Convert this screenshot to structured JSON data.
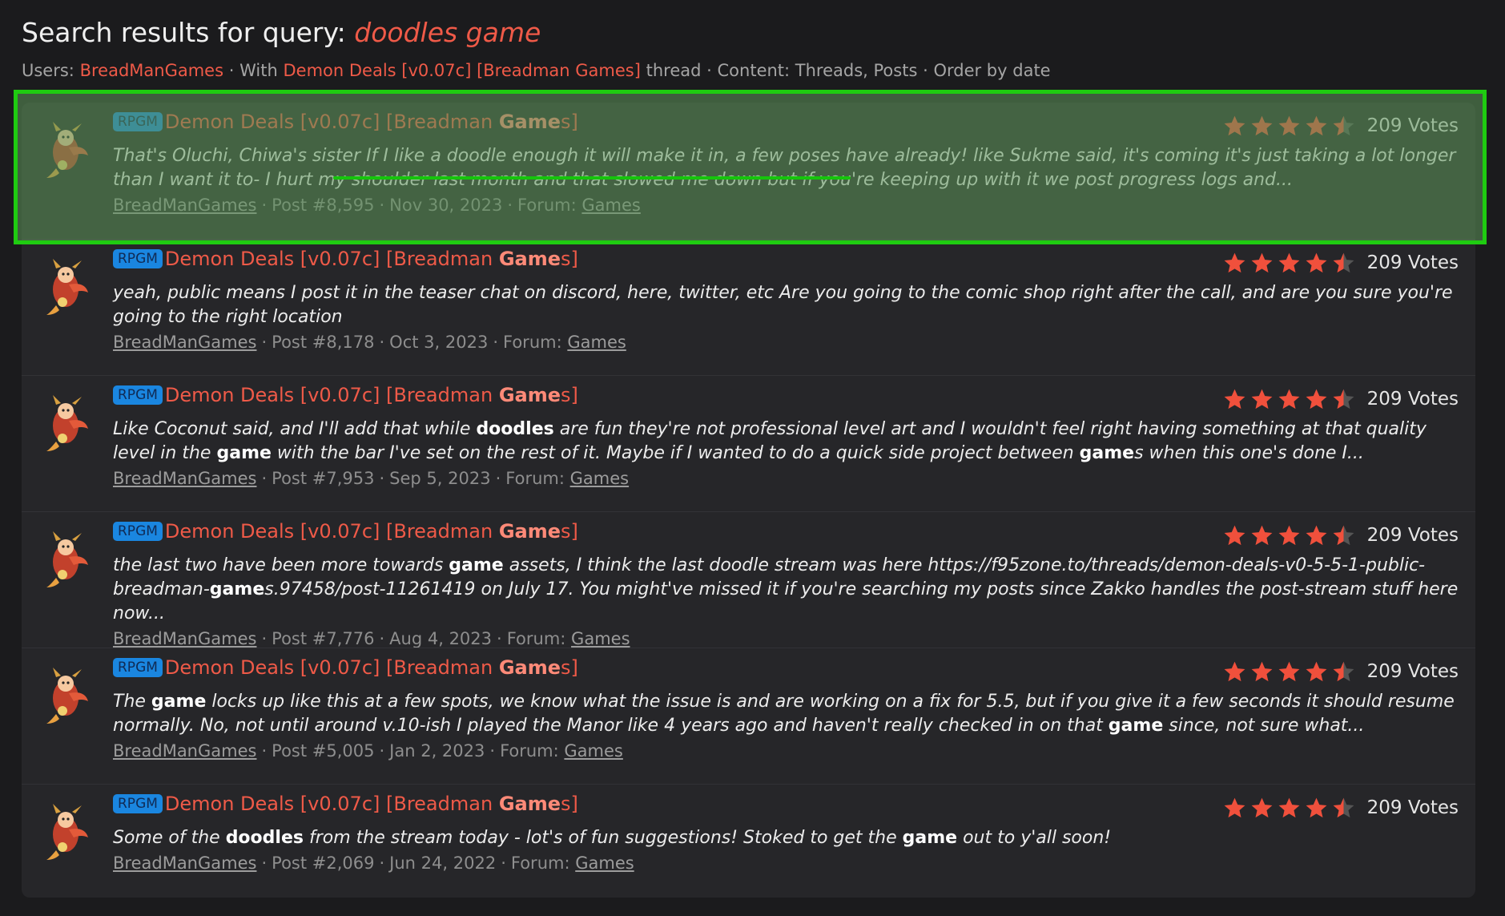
{
  "header": {
    "title_prefix": "Search results for query:",
    "query": "doodles game",
    "users_label": "Users:",
    "user": "BreadManGames",
    "with_label": "With",
    "thread": "Demon Deals [v0.07c] [Breadman Games]",
    "thread_suffix": "thread",
    "content_label": "Content: Threads, Posts",
    "order_label": "Order by date",
    "separator": "·"
  },
  "colors": {
    "accent": "#ef5a48",
    "highlight_border": "#1fcc11",
    "prefix_badge": "#1a86e0",
    "star": "#f0503c"
  },
  "results": [
    {
      "prefix": "RPGM",
      "title_main": "Demon Deals [v0.07c] [Breadman ",
      "title_bold": "Game",
      "title_tail": "s]",
      "rating": 4.5,
      "votes": "209 Votes",
      "snippet_html_parts": [
        {
          "t": "That's Oluchi, Chiwa's sister If I like a doodle enough it will make it in, a few poses have already! like Sukme said, it's coming it's just taking a lot longer than I want it to- I hurt my shoulder last month and that slowed me down but if you're keeping up with it we post progress logs and..."
        }
      ],
      "author": "BreadManGames",
      "post": "Post #8,595",
      "date": "Nov 30, 2023",
      "forum_label": "Forum:",
      "forum": "Games"
    },
    {
      "prefix": "RPGM",
      "title_main": "Demon Deals [v0.07c] [Breadman ",
      "title_bold": "Game",
      "title_tail": "s]",
      "rating": 4.5,
      "votes": "209 Votes",
      "snippet_html_parts": [
        {
          "t": "yeah, public means I post it in the teaser chat on discord, here, twitter, etc Are you going to the comic shop right after the call, and are you sure you're going to the right location"
        }
      ],
      "author": "BreadManGames",
      "post": "Post #8,178",
      "date": "Oct 3, 2023",
      "forum_label": "Forum:",
      "forum": "Games"
    },
    {
      "prefix": "RPGM",
      "title_main": "Demon Deals [v0.07c] [Breadman ",
      "title_bold": "Game",
      "title_tail": "s]",
      "rating": 4.5,
      "votes": "209 Votes",
      "snippet_html_parts": [
        {
          "t": "Like Coconut said, and I'll add that while "
        },
        {
          "b": "doodles"
        },
        {
          "t": " are fun they're not professional level art and I wouldn't feel right having something at that quality level in the "
        },
        {
          "b": "game"
        },
        {
          "t": " with the bar I've set on the rest of it. Maybe if I wanted to do a quick side project between "
        },
        {
          "b": "game"
        },
        {
          "t": "s when this one's done I..."
        }
      ],
      "author": "BreadManGames",
      "post": "Post #7,953",
      "date": "Sep 5, 2023",
      "forum_label": "Forum:",
      "forum": "Games"
    },
    {
      "prefix": "RPGM",
      "title_main": "Demon Deals [v0.07c] [Breadman ",
      "title_bold": "Game",
      "title_tail": "s]",
      "rating": 4.5,
      "votes": "209 Votes",
      "snippet_html_parts": [
        {
          "t": "the last two have been more towards "
        },
        {
          "b": "game"
        },
        {
          "t": " assets, I think the last doodle stream was here https://f95zone.to/threads/demon-deals-v0-5-5-1-public-breadman-"
        },
        {
          "b": "game"
        },
        {
          "t": "s.97458/post-11261419 on July 17. You might've missed it if you're searching my posts since Zakko handles the post-stream stuff here now..."
        }
      ],
      "author": "BreadManGames",
      "post": "Post #7,776",
      "date": "Aug 4, 2023",
      "forum_label": "Forum:",
      "forum": "Games"
    },
    {
      "prefix": "RPGM",
      "title_main": "Demon Deals [v0.07c] [Breadman ",
      "title_bold": "Game",
      "title_tail": "s]",
      "rating": 4.5,
      "votes": "209 Votes",
      "snippet_html_parts": [
        {
          "t": "The "
        },
        {
          "b": "game"
        },
        {
          "t": " locks up like this at a few spots, we know what the issue is and are working on a fix for 5.5, but if you give it a few seconds it should resume normally. No, not until around v.10-ish I played the Manor like 4 years ago and haven't really checked in on that "
        },
        {
          "b": "game"
        },
        {
          "t": " since, not sure what..."
        }
      ],
      "author": "BreadManGames",
      "post": "Post #5,005",
      "date": "Jan 2, 2023",
      "forum_label": "Forum:",
      "forum": "Games"
    },
    {
      "prefix": "RPGM",
      "title_main": "Demon Deals [v0.07c] [Breadman ",
      "title_bold": "Game",
      "title_tail": "s]",
      "rating": 4.5,
      "votes": "209 Votes",
      "snippet_html_parts": [
        {
          "t": "Some of the "
        },
        {
          "b": "doodles"
        },
        {
          "t": " from the stream today - lot's of fun suggestions! Stoked to get the "
        },
        {
          "b": "game"
        },
        {
          "t": " out to y'all soon!"
        }
      ],
      "author": "BreadManGames",
      "post": "Post #2,069",
      "date": "Jun 24, 2022",
      "forum_label": "Forum:",
      "forum": "Games"
    }
  ]
}
